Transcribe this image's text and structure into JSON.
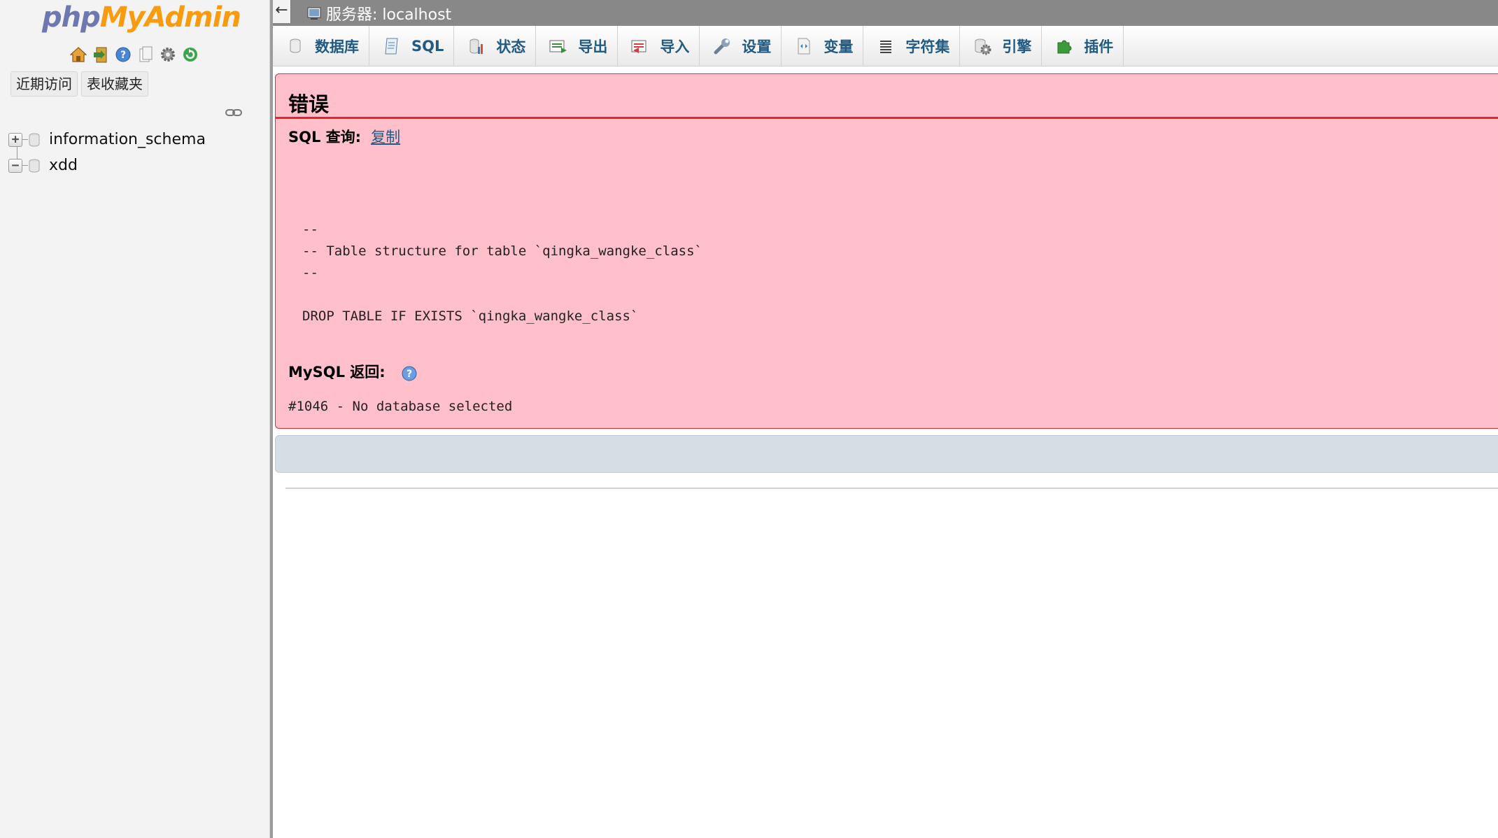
{
  "sidebar": {
    "logo": {
      "part1": "php",
      "part2": "MyAdmin"
    },
    "nav_icons": [
      "home-icon",
      "logout-icon",
      "help-icon",
      "docs-icon",
      "settings-icon",
      "reload-icon"
    ],
    "tabs": [
      {
        "label": "近期访问"
      },
      {
        "label": "表收藏夹"
      }
    ],
    "databases": [
      {
        "name": "information_schema",
        "expander": "+"
      },
      {
        "name": "xdd",
        "expander": "−"
      }
    ]
  },
  "topbar": {
    "collapse_glyph": "←",
    "server_label": "服务器: localhost"
  },
  "menu": [
    {
      "label": "数据库",
      "icon": "database-icon"
    },
    {
      "label": "SQL",
      "icon": "sql-icon"
    },
    {
      "label": "状态",
      "icon": "status-icon"
    },
    {
      "label": "导出",
      "icon": "export-icon"
    },
    {
      "label": "导入",
      "icon": "import-icon"
    },
    {
      "label": "设置",
      "icon": "settings-icon"
    },
    {
      "label": "变量",
      "icon": "variables-icon"
    },
    {
      "label": "字符集",
      "icon": "charset-icon"
    },
    {
      "label": "引擎",
      "icon": "engine-icon"
    },
    {
      "label": "插件",
      "icon": "plugin-icon"
    }
  ],
  "error": {
    "title": "错误",
    "sql_query_label": "SQL 查询:",
    "copy_link": "复制",
    "sql_code": "--\n-- Table structure for table `qingka_wangke_class`\n--\n\nDROP TABLE IF EXISTS `qingka_wangke_class`",
    "mysql_return_label": "MySQL 返回:",
    "message": "#1046 - No database selected"
  },
  "colors": {
    "error_bg": "#ffc0cb",
    "error_rule": "#e5242c",
    "menu_text": "#235a81",
    "topbar_bg": "#888888",
    "logo_php": "#6c78af",
    "logo_myadmin": "#f89c0e"
  }
}
